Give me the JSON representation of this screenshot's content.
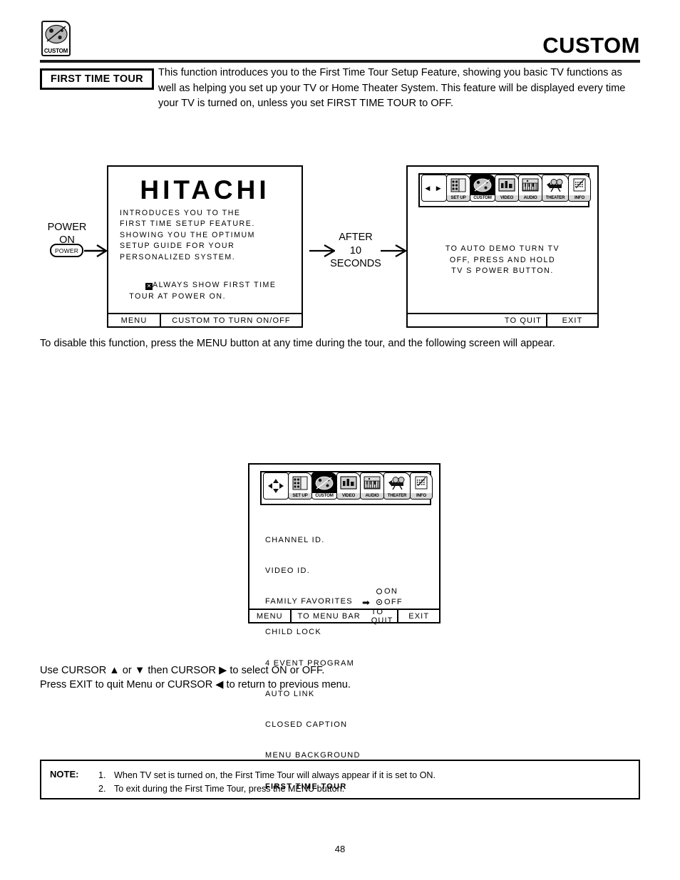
{
  "header": {
    "title": "CUSTOM",
    "logo_label": "CUSTOM",
    "logo_icon": "palette-icon"
  },
  "section": {
    "badge": "FIRST TIME TOUR",
    "intro_paragraph": "This function introduces you to the First Time Tour Setup Feature, showing you basic TV functions as well as helping you set up your TV or Home Theater System. This feature will be displayed every time your TV is turned on, unless you set FIRST TIME TOUR to OFF.",
    "disable_paragraph": "To disable this function, press the MENU button at any time during the tour, and the following screen will appear.",
    "usage_line1": "Use CURSOR ▲ or ▼ then CURSOR ▶ to select ON or OFF.",
    "usage_line2": "Press EXIT to quit Menu or CURSOR ◀ to return to previous menu."
  },
  "flow": {
    "power_label_line1": "POWER",
    "power_label_line2": "ON",
    "power_button": "POWER",
    "transition_line1": "AFTER",
    "transition_line2": "10",
    "transition_line3": "SECONDS"
  },
  "tv_screen_1": {
    "brand": "HITACHI",
    "osd_text": "INTRODUCES YOU TO THE\nFIRST TIME SETUP FEATURE.\nSHOWING YOU THE OPTIMUM\nSETUP GUIDE FOR YOUR\nPERSONALIZED SYSTEM.",
    "checkbox_glyph": "✕",
    "checkbox_text": "ALWAYS SHOW FIRST TIME\n   TOUR AT POWER ON.",
    "footer": [
      {
        "label": "MENU"
      },
      {
        "label": "CUSTOM TO TURN   ON/OFF"
      }
    ]
  },
  "tv_screen_2": {
    "osd_text": "TO AUTO DEMO TURN TV\nOFF, PRESS AND HOLD\nTV S POWER BUTTON.",
    "footer": [
      {
        "label": "TO QUIT"
      },
      {
        "label": "EXIT"
      }
    ]
  },
  "menu_bar": {
    "nav_glyph": "◀ ▶",
    "nav_glyph_4way": "4-way-cursor-icon",
    "tabs": [
      {
        "label": "SET UP",
        "icon": "setup-icon",
        "selected": false
      },
      {
        "label": "CUSTOM",
        "icon": "palette-icon",
        "selected": true
      },
      {
        "label": "VIDEO",
        "icon": "video-icon",
        "selected": false
      },
      {
        "label": "AUDIO",
        "icon": "audio-icon",
        "selected": false
      },
      {
        "label": "THEATER",
        "icon": "theater-icon",
        "selected": false
      },
      {
        "label": "INFO",
        "icon": "info-icon",
        "selected": false
      }
    ]
  },
  "custom_menu": {
    "items": [
      "CHANNEL ID.",
      "VIDEO ID.",
      "FAMILY FAVORITES",
      "CHILD LOCK",
      "4 EVENT PROGRAM",
      "AUTO LINK",
      "CLOSED CAPTION",
      "MENU BACKGROUND"
    ],
    "highlighted_item": "FIRST TIME TOUR",
    "option_on": "ON",
    "option_off": "OFF",
    "selected_option": "OFF",
    "cursor_glyph": "➡",
    "footer": [
      {
        "label": "MENU"
      },
      {
        "label": "TO MENU BAR"
      },
      {
        "label": "TO QUIT"
      },
      {
        "label": "EXIT"
      }
    ]
  },
  "note": {
    "label": "NOTE:",
    "items": [
      {
        "num": "1.",
        "text": "When TV set is turned on, the First Time Tour will always appear if it is set to ON."
      },
      {
        "num": "2.",
        "text": "To exit during the First Time Tour, press the MENU button."
      }
    ]
  },
  "page_number": "48"
}
